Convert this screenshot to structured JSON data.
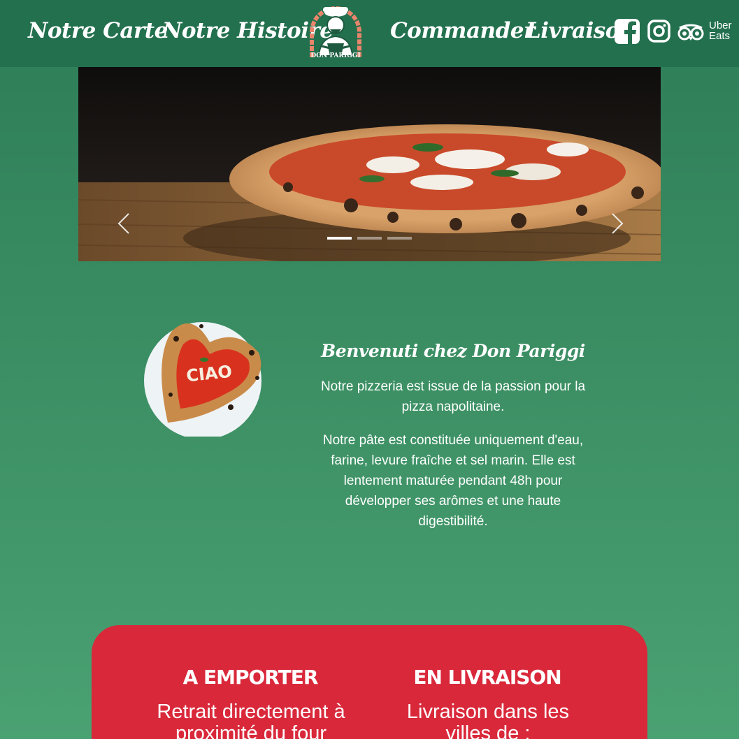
{
  "header": {
    "nav": {
      "carte": "Notre Carte",
      "histoire": "Notre Histoire",
      "commander": "Commander",
      "livraison": "Livraison"
    },
    "logo_text": "DON PARIGGI",
    "social": {
      "facebook_icon": "facebook-icon",
      "instagram_icon": "instagram-icon",
      "tripadvisor_icon": "tripadvisor-icon",
      "ubereats_line1": "Uber",
      "ubereats_line2": "Eats"
    }
  },
  "carousel": {
    "slide_count": 3,
    "active_slide": 1,
    "prev_icon": "chevron-left-icon",
    "next_icon": "chevron-right-icon"
  },
  "intro": {
    "image_text": "CIAO",
    "title": "Benvenuti chez Don Pariggi",
    "paragraph1": "Notre pizzeria est issue de la passion pour la pizza napolitaine.",
    "paragraph2": "Notre pâte est constituée uniquement d'eau, farine, levure fraîche et sel marin. Elle est lentement maturée pendant 48h pour développer ses arômes et une haute digestibilité."
  },
  "services": {
    "emporter": {
      "title": "A EMPORTER",
      "text": "Retrait directement à proximité du four"
    },
    "livraison": {
      "title": "EN LIVRAISON",
      "text": "Livraison dans les villes de :"
    }
  },
  "colors": {
    "header_bg": "#23704f",
    "page_green_top": "#2d7d58",
    "page_green_bottom": "#4aa172",
    "card_red": "#d9283a",
    "logo_accent": "#e8856a"
  }
}
